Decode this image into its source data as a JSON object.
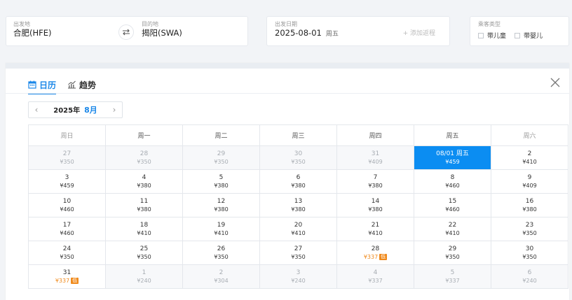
{
  "route": {
    "departure_label": "出发地",
    "departure_value": "合肥(HFE)",
    "arrival_label": "目的地",
    "arrival_value": "揭阳(SWA)"
  },
  "date": {
    "label": "出发日期",
    "value": "2025-08-01",
    "weekday": "周五",
    "add_return": "+ 添加返程"
  },
  "passengers": {
    "label": "乘客类型",
    "options": [
      "带儿童",
      "带婴儿"
    ]
  },
  "tabs": {
    "calendar": "日历",
    "trend": "趋势"
  },
  "month_nav": {
    "prev": "‹",
    "year": "2025年",
    "month": "8月",
    "next": "›"
  },
  "calendar": {
    "weekdays": [
      "周日",
      "周一",
      "周二",
      "周三",
      "周四",
      "周五",
      "周六"
    ],
    "low_badge": "低",
    "weeks": [
      [
        {
          "day": "27",
          "price": "¥350",
          "other": true
        },
        {
          "day": "28",
          "price": "¥350",
          "other": true
        },
        {
          "day": "29",
          "price": "¥350",
          "other": true
        },
        {
          "day": "30",
          "price": "¥350",
          "other": true
        },
        {
          "day": "31",
          "price": "¥409",
          "other": true
        },
        {
          "day": "08/01 周五",
          "price": "¥459",
          "selected": true
        },
        {
          "day": "2",
          "price": "¥410"
        }
      ],
      [
        {
          "day": "3",
          "price": "¥459"
        },
        {
          "day": "4",
          "price": "¥380"
        },
        {
          "day": "5",
          "price": "¥380"
        },
        {
          "day": "6",
          "price": "¥380"
        },
        {
          "day": "7",
          "price": "¥380"
        },
        {
          "day": "8",
          "price": "¥460"
        },
        {
          "day": "9",
          "price": "¥409"
        }
      ],
      [
        {
          "day": "10",
          "price": "¥460"
        },
        {
          "day": "11",
          "price": "¥380"
        },
        {
          "day": "12",
          "price": "¥380"
        },
        {
          "day": "13",
          "price": "¥380"
        },
        {
          "day": "14",
          "price": "¥380"
        },
        {
          "day": "15",
          "price": "¥460"
        },
        {
          "day": "16",
          "price": "¥380"
        }
      ],
      [
        {
          "day": "17",
          "price": "¥460"
        },
        {
          "day": "18",
          "price": "¥410"
        },
        {
          "day": "19",
          "price": "¥410"
        },
        {
          "day": "20",
          "price": "¥410"
        },
        {
          "day": "21",
          "price": "¥410"
        },
        {
          "day": "22",
          "price": "¥410"
        },
        {
          "day": "23",
          "price": "¥350"
        }
      ],
      [
        {
          "day": "24",
          "price": "¥350"
        },
        {
          "day": "25",
          "price": "¥350"
        },
        {
          "day": "26",
          "price": "¥350"
        },
        {
          "day": "27",
          "price": "¥350"
        },
        {
          "day": "28",
          "price": "¥337",
          "low": true
        },
        {
          "day": "29",
          "price": "¥350"
        },
        {
          "day": "30",
          "price": "¥350"
        }
      ],
      [
        {
          "day": "31",
          "price": "¥337",
          "low": true
        },
        {
          "day": "1",
          "price": "¥240",
          "other": true
        },
        {
          "day": "2",
          "price": "¥304",
          "other": true
        },
        {
          "day": "3",
          "price": "¥240",
          "other": true
        },
        {
          "day": "4",
          "price": "¥337",
          "other": true
        },
        {
          "day": "5",
          "price": "¥337",
          "other": true
        },
        {
          "day": "6",
          "price": "¥240",
          "other": true
        }
      ]
    ]
  },
  "colors": {
    "accent": "#1a87e8",
    "selected": "#0b8df2",
    "low_price": "#f08a1c"
  }
}
